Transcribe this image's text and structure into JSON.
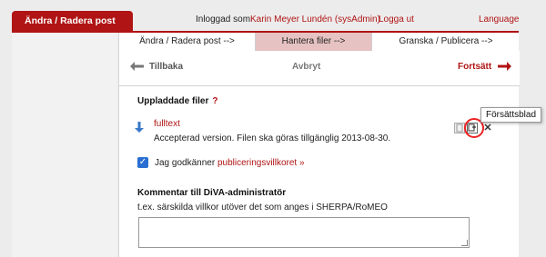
{
  "sidebar": {
    "tab_label": "Ändra / Radera post"
  },
  "topbar": {
    "logged_in_label": "Inloggad som",
    "user_name": "Karin Meyer Lundén (sysAdmin)",
    "logout_label": "Logga ut",
    "language_label": "Language"
  },
  "steps": [
    {
      "label": "Ändra / Radera post -->"
    },
    {
      "label": "Hantera filer -->",
      "active": true
    },
    {
      "label": "Granska / Publicera -->"
    }
  ],
  "nav": {
    "back_label": "Tillbaka",
    "cancel_label": "Avbryt",
    "next_label": "Fortsätt"
  },
  "files": {
    "heading": "Uppladdade filer",
    "help": "?",
    "items": [
      {
        "name": "fulltext",
        "description": "Accepterad version. Filen ska göras tillgänglig 2013-08-30.",
        "actions": [
          "view-icon",
          "cover-sheet-icon",
          "delete-icon"
        ]
      }
    ],
    "tooltip": "Försättsblad"
  },
  "acceptance": {
    "checked": true,
    "text": "Jag godkänner",
    "link": "publiceringsvillkoret »"
  },
  "comment": {
    "heading": "Kommentar till DiVA-administratör",
    "help": "t.ex. särskilda villkor utöver det som anges i SHERPA/RoMEO",
    "value": ""
  },
  "colors": {
    "accent": "#b01414",
    "active_step": "#e7c2c2",
    "highlight": "#e22222"
  }
}
